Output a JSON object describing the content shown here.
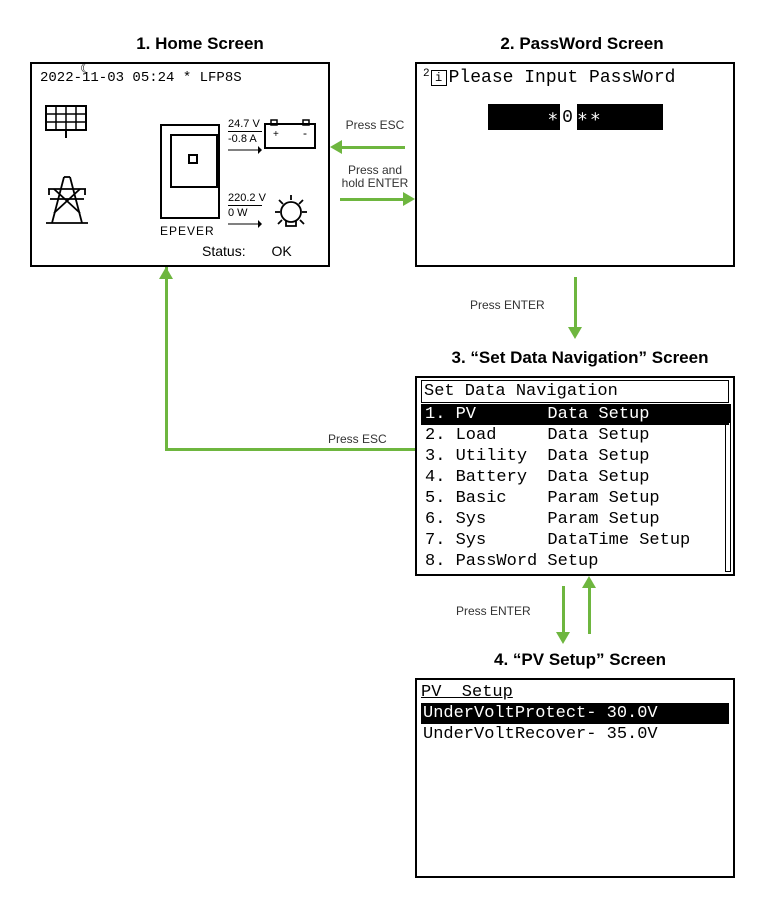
{
  "titles": {
    "s1": "1. Home Screen",
    "s2": "2. PassWord Screen",
    "s3": "3. “Set Data Navigation” Screen",
    "s4": "4. “PV Setup” Screen"
  },
  "arrows": {
    "esc1": "Press ESC",
    "hold_enter": "Press and hold ENTER",
    "enter2": "Press ENTER",
    "esc3": "Press ESC",
    "enter3": "Press ENTER"
  },
  "home": {
    "header": "2022-11-03  05:24  *  LFP8S",
    "brand": "EPEVER",
    "batt_v": "24.7 V",
    "batt_a": "-0.8  A",
    "out_v": "220.2 V",
    "out_w": "0  W",
    "status_label": "Status:",
    "status_value": "OK"
  },
  "password": {
    "prompt": "Please Input PassWord",
    "mask_left": "∗",
    "cursor": "0",
    "mask_right": "∗∗"
  },
  "nav": {
    "header": "Set Data Navigation",
    "items": [
      "1. PV       Data Setup",
      "2. Load     Data Setup",
      "3. Utility  Data Setup",
      "4. Battery  Data Setup",
      "5. Basic    Param Setup",
      "6. Sys      Param Setup",
      "7. Sys      DataTime Setup",
      "8. PassWord Setup"
    ],
    "selected": 0
  },
  "pv": {
    "header": "PV  Setup",
    "rows": [
      "UnderVoltProtect- 30.0V",
      "UnderVoltRecover- 35.0V"
    ],
    "selected": 0
  }
}
